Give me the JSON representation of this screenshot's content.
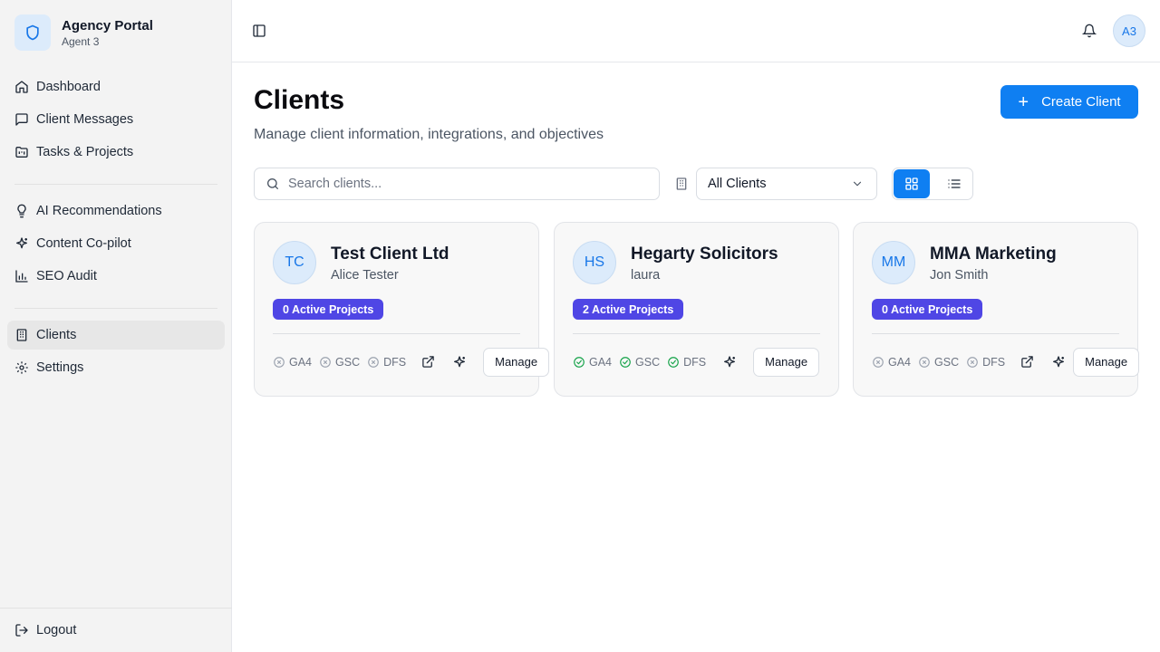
{
  "brand": {
    "title": "Agency Portal",
    "subtitle": "Agent 3"
  },
  "sidebar": {
    "items": [
      {
        "label": "Dashboard",
        "icon": "home-icon"
      },
      {
        "label": "Client Messages",
        "icon": "message-icon"
      },
      {
        "label": "Tasks & Projects",
        "icon": "folder-kanban-icon"
      },
      {
        "label": "AI Recommendations",
        "icon": "lightbulb-icon"
      },
      {
        "label": "Content Co-pilot",
        "icon": "sparkles-icon"
      },
      {
        "label": "SEO Audit",
        "icon": "bar-chart-icon"
      },
      {
        "label": "Clients",
        "icon": "building-icon",
        "active": true
      },
      {
        "label": "Settings",
        "icon": "gear-icon"
      }
    ],
    "logout_label": "Logout"
  },
  "header": {
    "user_initials": "A3"
  },
  "main": {
    "title": "Clients",
    "subtitle": "Manage client information, integrations, and objectives",
    "create_label": "Create Client",
    "search_placeholder": "Search clients...",
    "filter_value": "All Clients",
    "view_mode": "grid"
  },
  "clients": [
    {
      "initials": "TC",
      "name": "Test Client Ltd",
      "contact": "Alice Tester",
      "projects": "0 Active Projects",
      "integrations": [
        {
          "label": "GA4",
          "connected": false
        },
        {
          "label": "GSC",
          "connected": false
        },
        {
          "label": "DFS",
          "connected": false
        }
      ],
      "has_external_link": true,
      "manage_label": "Manage"
    },
    {
      "initials": "HS",
      "name": "Hegarty Solicitors",
      "contact": "laura",
      "projects": "2 Active Projects",
      "integrations": [
        {
          "label": "GA4",
          "connected": true
        },
        {
          "label": "GSC",
          "connected": true
        },
        {
          "label": "DFS",
          "connected": true
        }
      ],
      "has_external_link": false,
      "manage_label": "Manage"
    },
    {
      "initials": "MM",
      "name": "MMA Marketing",
      "contact": "Jon Smith",
      "projects": "0 Active Projects",
      "integrations": [
        {
          "label": "GA4",
          "connected": false
        },
        {
          "label": "GSC",
          "connected": false
        },
        {
          "label": "DFS",
          "connected": false
        }
      ],
      "has_external_link": true,
      "manage_label": "Manage"
    }
  ],
  "colors": {
    "accent": "#0f7ff2",
    "badge": "#4f46e5",
    "connected": "#16a34a",
    "disconnected": "#9ca3af"
  }
}
